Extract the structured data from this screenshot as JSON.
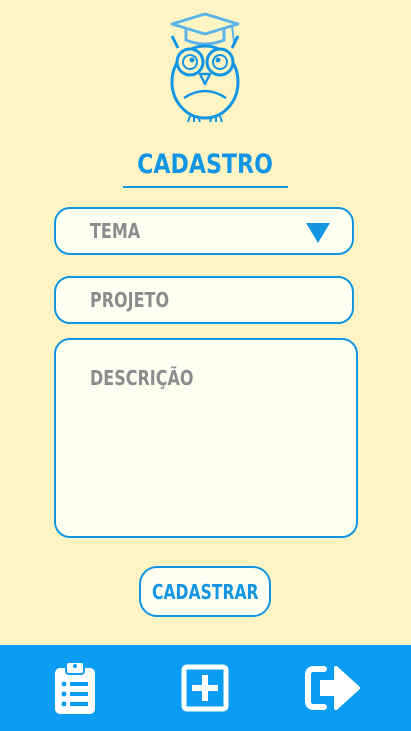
{
  "header": {
    "title": "CADASTRO",
    "logo_icon": "owl-graduate-icon"
  },
  "form": {
    "theme_select": {
      "placeholder": "TEMA",
      "icon": "dropdown-arrow-icon"
    },
    "project_input": {
      "placeholder": "PROJETO"
    },
    "description_input": {
      "placeholder": "DESCRIÇÃO"
    },
    "submit_label": "CADASTRAR"
  },
  "bottom_nav": {
    "items": [
      {
        "icon": "clipboard-list-icon"
      },
      {
        "icon": "plus-square-icon"
      },
      {
        "icon": "sign-out-icon"
      }
    ]
  },
  "colors": {
    "background": "#FFF4C4",
    "accent": "#1296E4",
    "nav_bar": "#0B9CF3",
    "placeholder": "#8C8C8C"
  }
}
